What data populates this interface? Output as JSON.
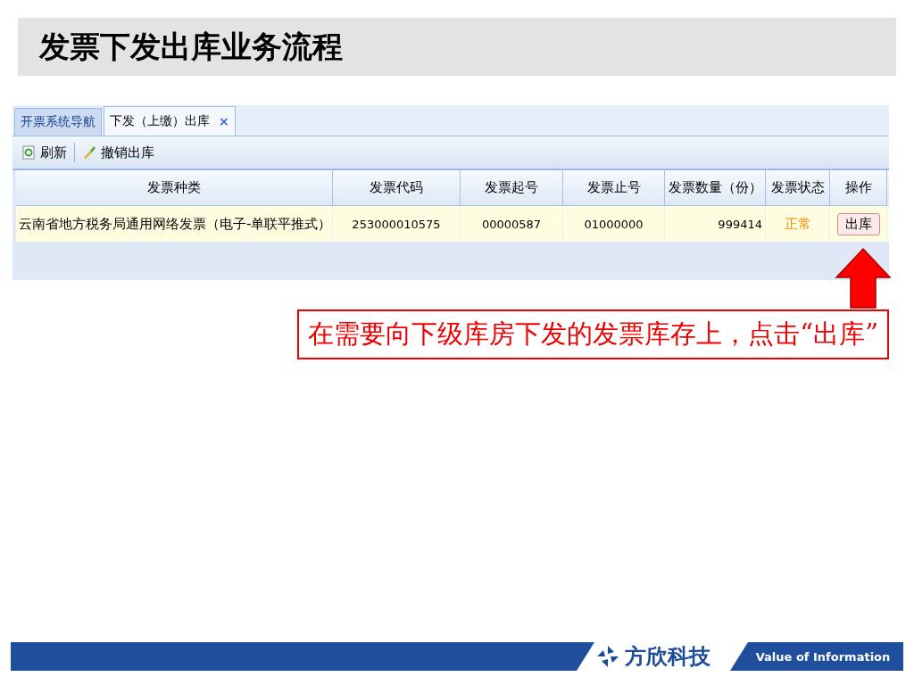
{
  "title": "发票下发出库业务流程",
  "tabs": [
    {
      "label": "开票系统导航",
      "selected": false
    },
    {
      "label": "下发（上缴）出库",
      "selected": true,
      "close": "×"
    }
  ],
  "toolbar": [
    {
      "label": "刷新",
      "kind": "refresh"
    },
    {
      "label": "撤销出库",
      "kind": "brush"
    }
  ],
  "table": {
    "columns": [
      "发票种类",
      "发票代码",
      "发票起号",
      "发票止号",
      "发票数量（份）",
      "发票状态",
      "操作"
    ],
    "rows": [
      {
        "cells": [
          "云南省地方税务局通用网络发票（电子-单联平推式）",
          "253000010575",
          "00000587",
          "01000000",
          "999414"
        ],
        "status": "正常",
        "action": "出库"
      }
    ]
  },
  "callout": "在需要向下级库房下发的发票库存上，点击“出库”",
  "footer": {
    "brand": "方欣科技",
    "slogan": "Value of Information"
  }
}
